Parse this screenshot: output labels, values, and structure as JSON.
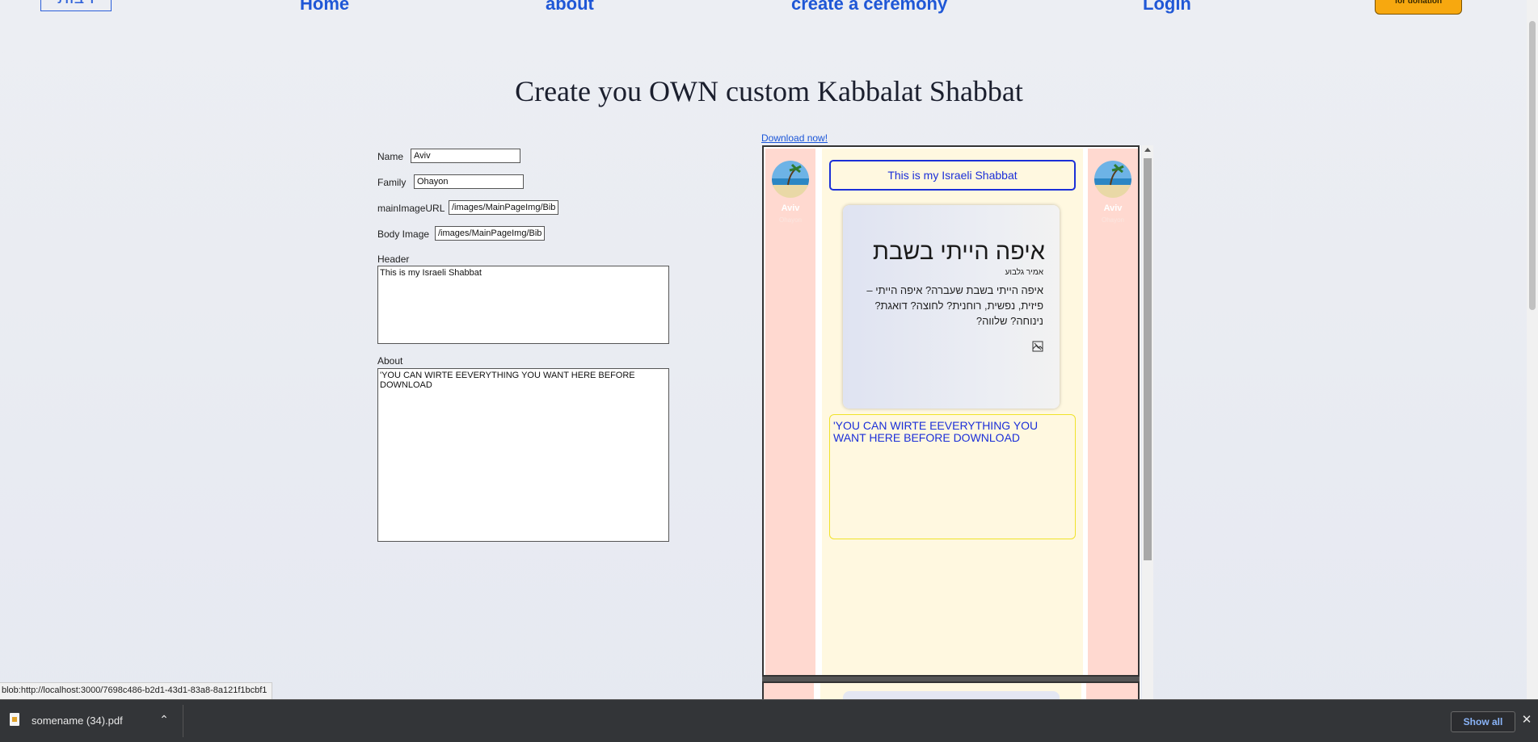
{
  "nav": {
    "logo_text": "רבות",
    "links": [
      "Home",
      "about",
      "create a ceremony",
      "Login"
    ],
    "donate_label": "for donation"
  },
  "page": {
    "title": "Create you OWN custom Kabbalat Shabbat"
  },
  "form": {
    "name_label": "Name",
    "name_value": "Aviv",
    "family_label": "Family",
    "family_value": "Ohayon",
    "main_image_label": "mainImageURL",
    "main_image_value": "/images/MainPageImg/Bib",
    "body_image_label": "Body Image",
    "body_image_value": "/images/MainPageImg/Bib",
    "header_label": "Header",
    "header_value": "This is my Israeli Shabbat",
    "about_label": "About",
    "about_value": "'YOU CAN WIRTE EEVERYTHING YOU WANT HERE BEFORE DOWNLOAD"
  },
  "preview": {
    "download_link": "Download now!",
    "left_name": "Aviv",
    "left_family": "Ohayon",
    "right_name": "Aviv",
    "right_family": "Ohayon",
    "header": "This is my Israeli Shabbat",
    "card_title": "איפה הייתי בשבת",
    "card_author": "אמיר גלבוע",
    "card_text": "איפה הייתי בשבת שעברה? איפה הייתי – פיזית, נפשית, רוחנית? לחוצה? דואגת? נינוחה? שלווה?",
    "about": "'YOU CAN WIRTE EEVERYTHING YOU WANT HERE BEFORE DOWNLOAD"
  },
  "status_bar": {
    "url": "blob:http://localhost:3000/7698c486-b2d1-43d1-83a8-8a121f1bcbf1"
  },
  "downloads": {
    "filename": "somename (34).pdf",
    "show_all": "Show all"
  },
  "colors": {
    "nav_link": "#1f57d6",
    "donate": "#f7a80f",
    "side_col": "#ffd9d0",
    "center_col": "#fff8e0",
    "header_border": "#1b2fd8",
    "about_border": "#f0e22a"
  }
}
